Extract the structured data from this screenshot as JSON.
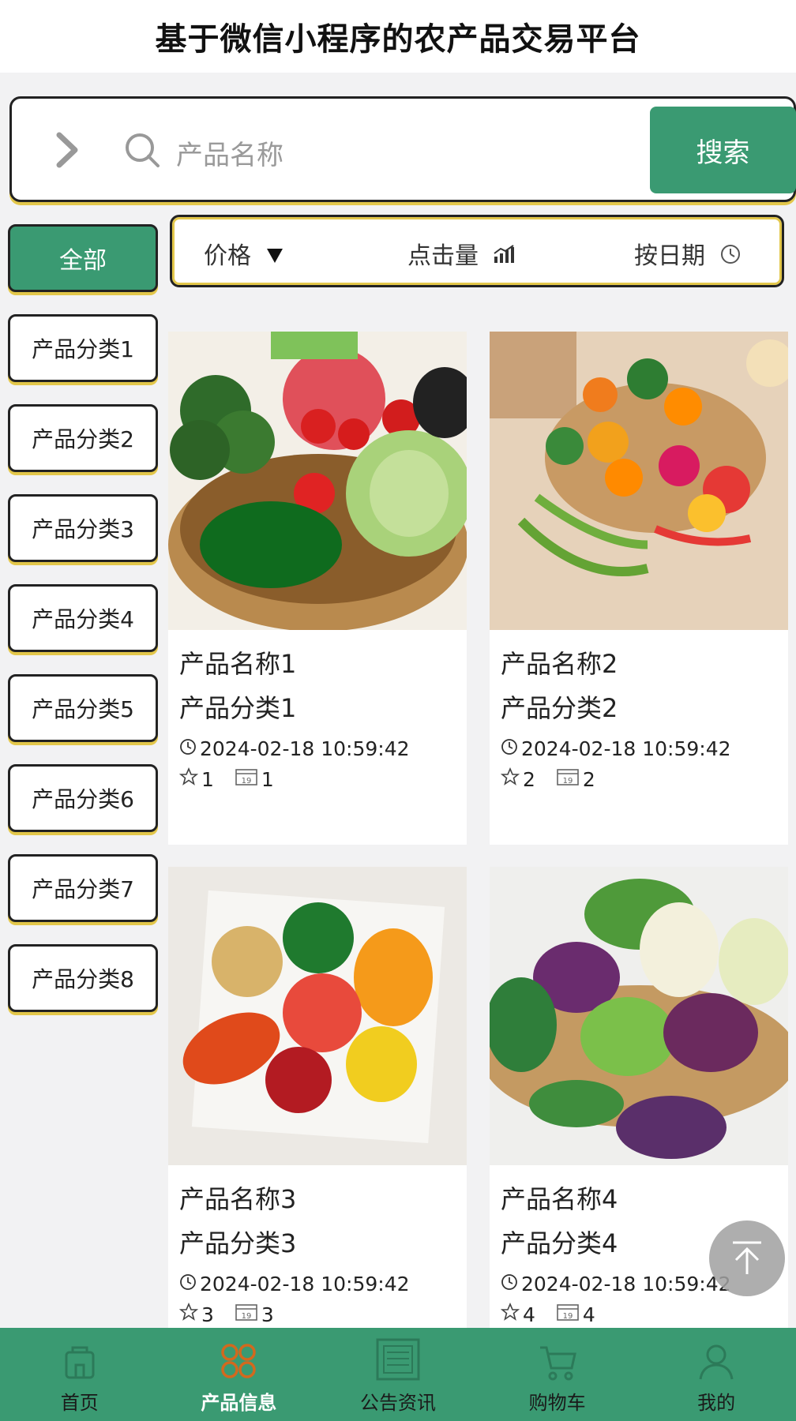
{
  "header": {
    "title": "基于微信小程序的农产品交易平台"
  },
  "search": {
    "placeholder": "产品名称",
    "button_label": "搜索"
  },
  "categories": {
    "all_label": "全部",
    "items": [
      "产品分类1",
      "产品分类2",
      "产品分类3",
      "产品分类4",
      "产品分类5",
      "产品分类6",
      "产品分类7",
      "产品分类8"
    ]
  },
  "sort": {
    "price_label": "价格",
    "clicks_label": "点击量",
    "date_label": "按日期"
  },
  "products": [
    {
      "name": "产品名称1",
      "category": "产品分类1",
      "time": "2024-02-18 10:59:42",
      "favorites": "1",
      "clicks": "1"
    },
    {
      "name": "产品名称2",
      "category": "产品分类2",
      "time": "2024-02-18 10:59:42",
      "favorites": "2",
      "clicks": "2"
    },
    {
      "name": "产品名称3",
      "category": "产品分类3",
      "time": "2024-02-18 10:59:42",
      "favorites": "3",
      "clicks": "3"
    },
    {
      "name": "产品名称4",
      "category": "产品分类4",
      "time": "2024-02-18 10:59:42",
      "favorites": "4",
      "clicks": "4"
    }
  ],
  "tabbar": {
    "items": [
      {
        "label": "首页",
        "icon": "home-icon"
      },
      {
        "label": "产品信息",
        "icon": "grid-icon"
      },
      {
        "label": "公告资讯",
        "icon": "news-icon"
      },
      {
        "label": "购物车",
        "icon": "cart-icon"
      },
      {
        "label": "我的",
        "icon": "user-icon"
      }
    ],
    "active_index": 1
  },
  "colors": {
    "primary": "#3a9a72",
    "accent_shadow": "#e3c74a",
    "active_icon": "#d2691e"
  }
}
